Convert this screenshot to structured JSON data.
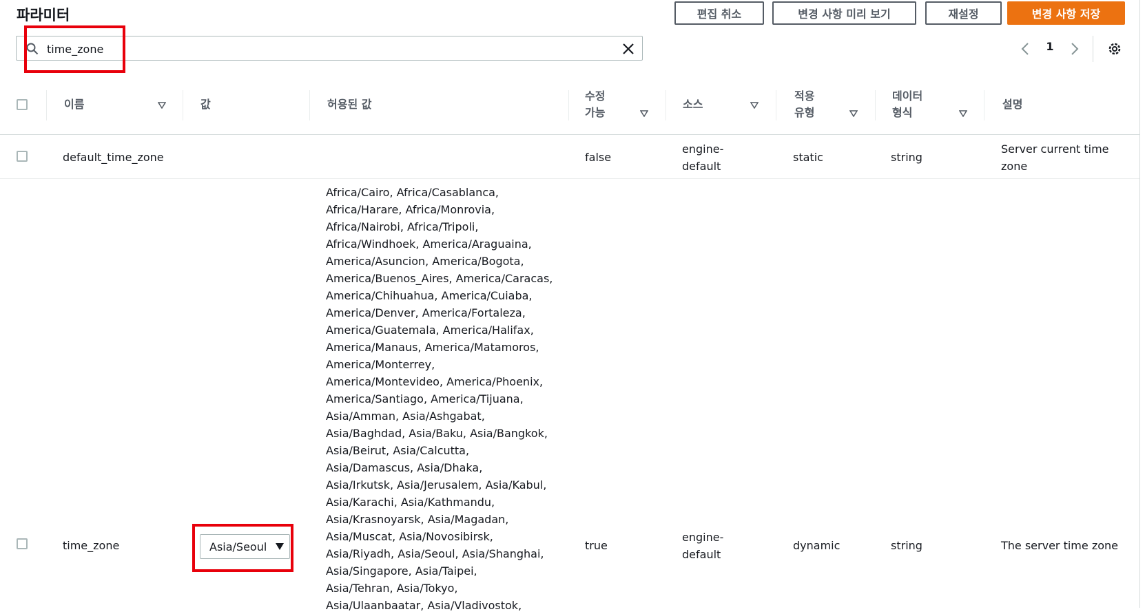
{
  "page": {
    "title": "파라미터"
  },
  "toolbar": {
    "cancel_edit": "편집 취소",
    "preview_changes": "변경 사항 미리 보기",
    "reset": "재설정",
    "save_changes": "변경 사항 저장"
  },
  "search": {
    "value": "time_zone",
    "placeholder": ""
  },
  "pagination": {
    "current_page": "1"
  },
  "table": {
    "columns": {
      "name": "이름",
      "value": "값",
      "allowed_values": "허용된 값",
      "modifiable_1": "수정",
      "modifiable_2": "가능",
      "source": "소스",
      "apply_type_1": "적용",
      "apply_type_2": "유형",
      "data_type_1": "데이터",
      "data_type_2": "형식",
      "description": "설명"
    },
    "rows": [
      {
        "name": "default_time_zone",
        "value": "",
        "allowed_values": "",
        "modifiable": "false",
        "source_1": "engine-",
        "source_2": "default",
        "apply_type": "static",
        "data_type": "string",
        "description_1": "Server current time",
        "description_2": "zone"
      },
      {
        "name": "time_zone",
        "value": "Asia/Seoul",
        "allowed_values": [
          "Africa/Cairo, Africa/Casablanca,",
          "Africa/Harare, Africa/Monrovia,",
          "Africa/Nairobi, Africa/Tripoli,",
          "Africa/Windhoek, America/Araguaina,",
          "America/Asuncion, America/Bogota,",
          "America/Buenos_Aires, America/Caracas,",
          "America/Chihuahua, America/Cuiaba,",
          "America/Denver, America/Fortaleza,",
          "America/Guatemala, America/Halifax,",
          "America/Manaus, America/Matamoros,",
          "America/Monterrey,",
          "America/Montevideo, America/Phoenix,",
          "America/Santiago, America/Tijuana,",
          "Asia/Amman, Asia/Ashgabat,",
          "Asia/Baghdad, Asia/Baku, Asia/Bangkok,",
          "Asia/Beirut, Asia/Calcutta,",
          "Asia/Damascus, Asia/Dhaka,",
          "Asia/Irkutsk, Asia/Jerusalem, Asia/Kabul,",
          "Asia/Karachi, Asia/Kathmandu,",
          "Asia/Krasnoyarsk, Asia/Magadan,",
          "Asia/Muscat, Asia/Novosibirsk,",
          "Asia/Riyadh, Asia/Seoul, Asia/Shanghai,",
          "Asia/Singapore, Asia/Taipei,",
          "Asia/Tehran, Asia/Tokyo,",
          "Asia/Ulaanbaatar, Asia/Vladivostok,"
        ],
        "modifiable": "true",
        "source_1": "engine-",
        "source_2": "default",
        "apply_type": "dynamic",
        "data_type": "string",
        "description": "The server time zone"
      }
    ]
  },
  "colors": {
    "primary": "#ec7211",
    "highlight": "#e8000b",
    "border": "#aab7b8",
    "header_text": "#545b64"
  },
  "icons": [
    "search-icon",
    "close-icon",
    "chevron-left-icon",
    "chevron-right-icon",
    "gear-icon",
    "sort-down-icon",
    "caret-down-icon"
  ]
}
